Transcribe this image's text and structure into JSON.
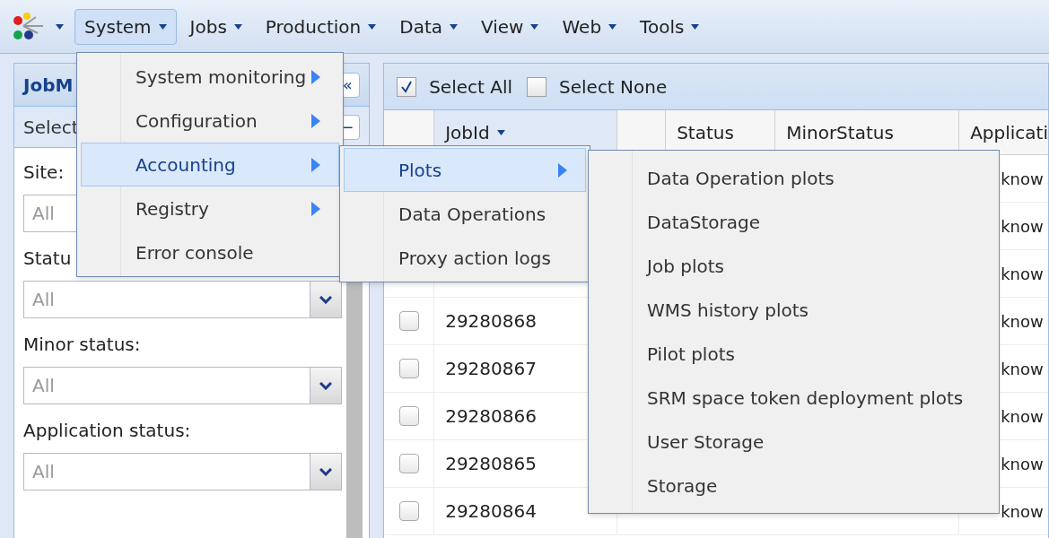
{
  "menubar": [
    {
      "label": "System",
      "selected": true
    },
    {
      "label": "Jobs",
      "selected": false
    },
    {
      "label": "Production",
      "selected": false
    },
    {
      "label": "Data",
      "selected": false
    },
    {
      "label": "View",
      "selected": false
    },
    {
      "label": "Web",
      "selected": false
    },
    {
      "label": "Tools",
      "selected": false
    }
  ],
  "left_panel": {
    "title": "JobM",
    "subtitle": "Select",
    "collapse": "«",
    "minimize": "−",
    "filters": [
      {
        "label": "Site:",
        "value": "All",
        "kind": "text"
      },
      {
        "label": "Statu",
        "value": "All",
        "kind": "select"
      },
      {
        "label": "Minor status:",
        "value": "All",
        "kind": "select"
      },
      {
        "label": "Application status:",
        "value": "All",
        "kind": "select"
      }
    ]
  },
  "toolbar": [
    {
      "label": "Select All",
      "checked": true
    },
    {
      "label": "Select None",
      "checked": false
    }
  ],
  "table": {
    "columns": [
      "JobId",
      "Status",
      "MinorStatus",
      "Applicati"
    ],
    "rows": [
      {
        "application": "know"
      },
      {
        "application": "know"
      },
      {
        "application": "know"
      },
      {
        "job_id": "29280868",
        "checked": false,
        "application": "know"
      },
      {
        "job_id": "29280867",
        "checked": false,
        "application": "know"
      },
      {
        "job_id": "29280866",
        "checked": false,
        "application": "know"
      },
      {
        "job_id": "29280865",
        "checked": false,
        "application": "know"
      },
      {
        "job_id": "29280864",
        "checked": false,
        "application": "know"
      }
    ]
  },
  "menus": [
    {
      "items": [
        {
          "label": "System monitoring",
          "submenu": true,
          "selected": false
        },
        {
          "label": "Configuration",
          "submenu": true,
          "selected": false
        },
        {
          "label": "Accounting",
          "submenu": true,
          "selected": true
        },
        {
          "label": "Registry",
          "submenu": true,
          "selected": false
        },
        {
          "label": "Error console",
          "submenu": false,
          "selected": false
        }
      ]
    },
    {
      "items": [
        {
          "label": "Plots",
          "submenu": true,
          "selected": true
        },
        {
          "label": "Data Operations",
          "submenu": false,
          "selected": false
        },
        {
          "label": "Proxy action logs",
          "submenu": false,
          "selected": false
        }
      ]
    },
    {
      "items": [
        {
          "label": "Data Operation plots",
          "submenu": false,
          "selected": false
        },
        {
          "label": "DataStorage",
          "submenu": false,
          "selected": false
        },
        {
          "label": "Job plots",
          "submenu": false,
          "selected": false
        },
        {
          "label": "WMS history plots",
          "submenu": false,
          "selected": false
        },
        {
          "label": "Pilot plots",
          "submenu": false,
          "selected": false
        },
        {
          "label": "SRM space token deployment plots",
          "submenu": false,
          "selected": false
        },
        {
          "label": "User Storage",
          "submenu": false,
          "selected": false
        },
        {
          "label": "Storage",
          "submenu": false,
          "selected": false
        }
      ]
    }
  ]
}
